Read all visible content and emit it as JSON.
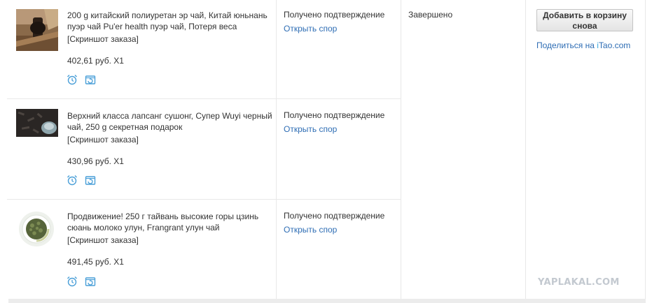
{
  "orders": [
    {
      "title": "200 g китайский полиуретан эр чай, Китай юньнань пуэр чай Pu'er health пуэр чай, Потеря веса",
      "snapshot": "[Скриншот заказа]",
      "price": "402,61 руб. X1",
      "status": "Получено подтверждение",
      "dispute": "Открыть спор",
      "thumb_icon": "pu-erh-tea-image"
    },
    {
      "title": "Верхний класса лапсанг сушонг, Супер Wuyi черный чай, 250 g секретная подарок",
      "snapshot": "[Скриншот заказа]",
      "price": "430,96 руб. X1",
      "status": "Получено подтверждение",
      "dispute": "Открыть спор",
      "thumb_icon": "black-tea-image"
    },
    {
      "title": "Продвижение! 250 г тайвань высокие горы цзинь сюань молоко улун, Frangrant улун чай",
      "snapshot": "[Скриншот заказа]",
      "price": "491,45 руб. X1",
      "status": "Получено подтверждение",
      "dispute": "Открыть спор",
      "thumb_icon": "oolong-tea-image"
    }
  ],
  "order_status": "Завершено",
  "actions": {
    "add_to_cart": "Добавить в корзину снова",
    "share_prefix": "Поделиться на ",
    "share_i": "i",
    "share_tao": "Tao",
    "share_suffix": ".com"
  },
  "watermark": "YAPLAKAL.COM",
  "colors": {
    "link": "#2e6db4",
    "icon": "#4a9fd8",
    "border": "#e8e8e8"
  }
}
